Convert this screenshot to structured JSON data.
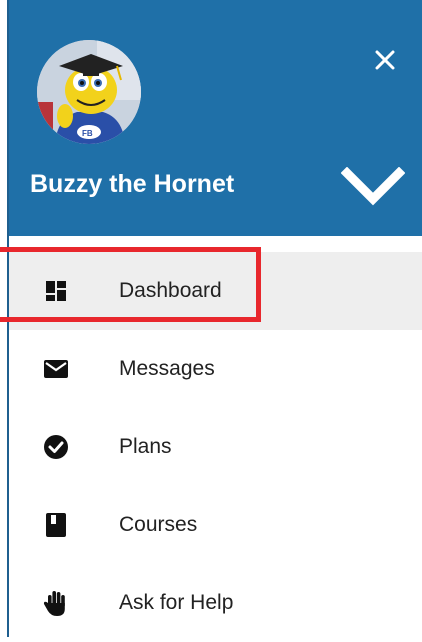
{
  "header": {
    "user_name": "Buzzy the Hornet",
    "close_icon": "close-icon",
    "expand_icon": "chevron-down-icon",
    "background_color": "#1f70a8"
  },
  "menu": {
    "items": [
      {
        "label": "Dashboard",
        "icon": "dashboard-icon",
        "active": true
      },
      {
        "label": "Messages",
        "icon": "envelope-icon",
        "active": false
      },
      {
        "label": "Plans",
        "icon": "check-circle-icon",
        "active": false
      },
      {
        "label": "Courses",
        "icon": "book-icon",
        "active": false
      },
      {
        "label": "Ask for Help",
        "icon": "hand-icon",
        "active": false
      }
    ]
  },
  "highlight_color": "#e8272d"
}
